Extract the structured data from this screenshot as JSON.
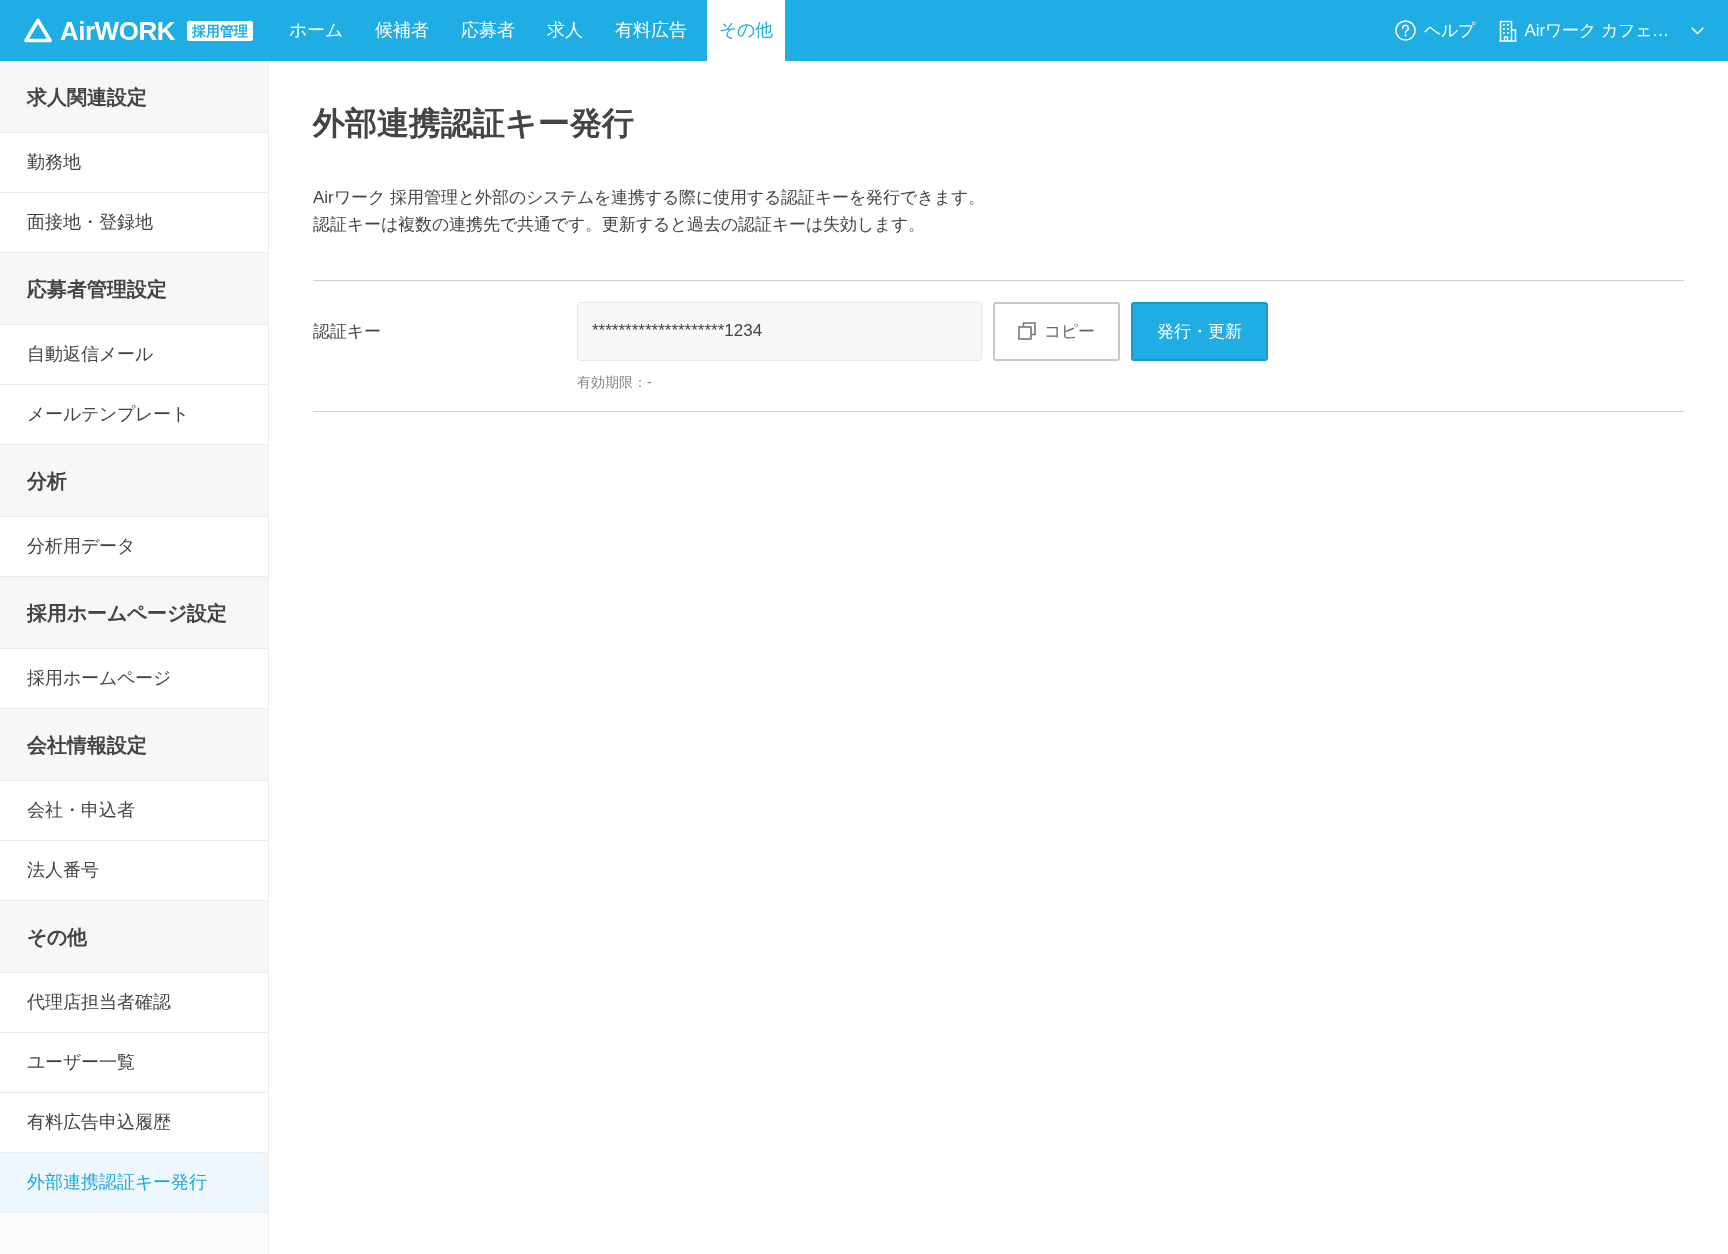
{
  "header": {
    "logo": {
      "wordmark": "AirWORK",
      "badge": "採用管理"
    },
    "nav": [
      {
        "label": "ホーム",
        "selected": false
      },
      {
        "label": "候補者",
        "selected": false
      },
      {
        "label": "応募者",
        "selected": false
      },
      {
        "label": "求人",
        "selected": false
      },
      {
        "label": "有料広告",
        "selected": false
      },
      {
        "label": "その他",
        "selected": true
      }
    ],
    "help": "ヘルプ",
    "account": "Airワーク カフェ…"
  },
  "sidebar": {
    "sections": [
      {
        "heading": "求人関連設定",
        "items": [
          {
            "label": "勤務地",
            "selected": false
          },
          {
            "label": "面接地・登録地",
            "selected": false
          }
        ]
      },
      {
        "heading": "応募者管理設定",
        "items": [
          {
            "label": "自動返信メール",
            "selected": false
          },
          {
            "label": "メールテンプレート",
            "selected": false
          }
        ]
      },
      {
        "heading": "分析",
        "items": [
          {
            "label": "分析用データ",
            "selected": false
          }
        ]
      },
      {
        "heading": "採用ホームページ設定",
        "items": [
          {
            "label": "採用ホームページ",
            "selected": false
          }
        ]
      },
      {
        "heading": "会社情報設定",
        "items": [
          {
            "label": "会社・申込者",
            "selected": false
          },
          {
            "label": "法人番号",
            "selected": false
          }
        ]
      },
      {
        "heading": "その他",
        "items": [
          {
            "label": "代理店担当者確認",
            "selected": false
          },
          {
            "label": "ユーザー一覧",
            "selected": false
          },
          {
            "label": "有料広告申込履歴",
            "selected": false
          },
          {
            "label": "外部連携認証キー発行",
            "selected": true
          }
        ]
      }
    ]
  },
  "main": {
    "title": "外部連携認証キー発行",
    "description": [
      "Airワーク 採用管理と外部のシステムを連携する際に使用する認証キーを発行できます。",
      "認証キーは複数の連携先で共通です。更新すると過去の認証キーは失効します。"
    ],
    "auth_key": {
      "label": "認証キー",
      "value": "********************1234",
      "copy_button": "コピー",
      "issue_button": "発行・更新",
      "expiry": "有効期限：-"
    }
  }
}
